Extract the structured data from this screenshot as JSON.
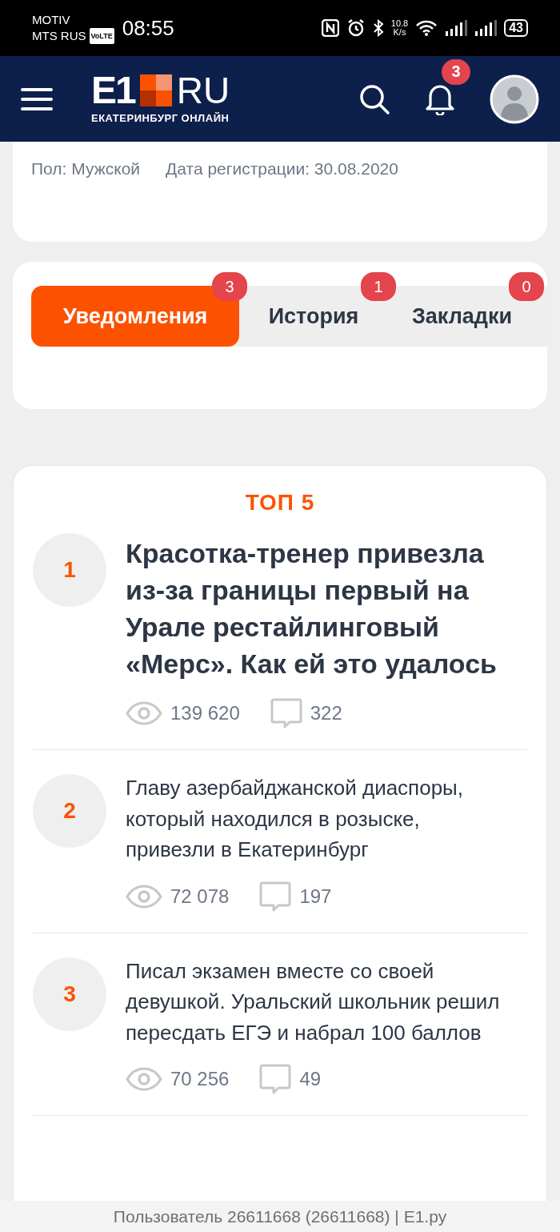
{
  "status_bar": {
    "carrier_1": "MOTIV",
    "carrier_2": "MTS RUS",
    "volte": "VoLTE",
    "time": "08:55",
    "speed_value": "10.8",
    "speed_unit": "K/s",
    "battery": "43"
  },
  "header": {
    "logo_main": "E1",
    "logo_ru": "RU",
    "logo_subtitle": "ЕКАТЕРИНБУРГ ОНЛАЙН",
    "notification_count": "3"
  },
  "profile": {
    "gender": "Пол: Мужской",
    "registered": "Дата регистрации: 30.08.2020"
  },
  "tabs": [
    {
      "label": "Уведомления",
      "count": "3",
      "selected": true
    },
    {
      "label": "История",
      "count": "1",
      "selected": false
    },
    {
      "label": "Закладки",
      "count": "0",
      "selected": false
    }
  ],
  "top": {
    "title": "ТОП 5",
    "items": [
      {
        "rank": "1",
        "kind": "lead",
        "title": "Красотка-тренер привезла из-за границы первый на Урале рестайлинговый «Мерс». Как ей это удалось",
        "views": "139 620",
        "comments": "322"
      },
      {
        "rank": "2",
        "kind": "normal",
        "title": "Главу азербайджанской диаспоры, который находился в розыске, привезли в Екатеринбург",
        "views": "72 078",
        "comments": "197"
      },
      {
        "rank": "3",
        "kind": "normal",
        "title": "Писал экзамен вместе со своей девушкой. Уральский школьник решил пересдать ЕГЭ и набрал 100 баллов",
        "views": "70 256",
        "comments": "49"
      }
    ]
  },
  "footer": {
    "text": "Пользователь 26611668 (26611668) | E1.ру"
  }
}
